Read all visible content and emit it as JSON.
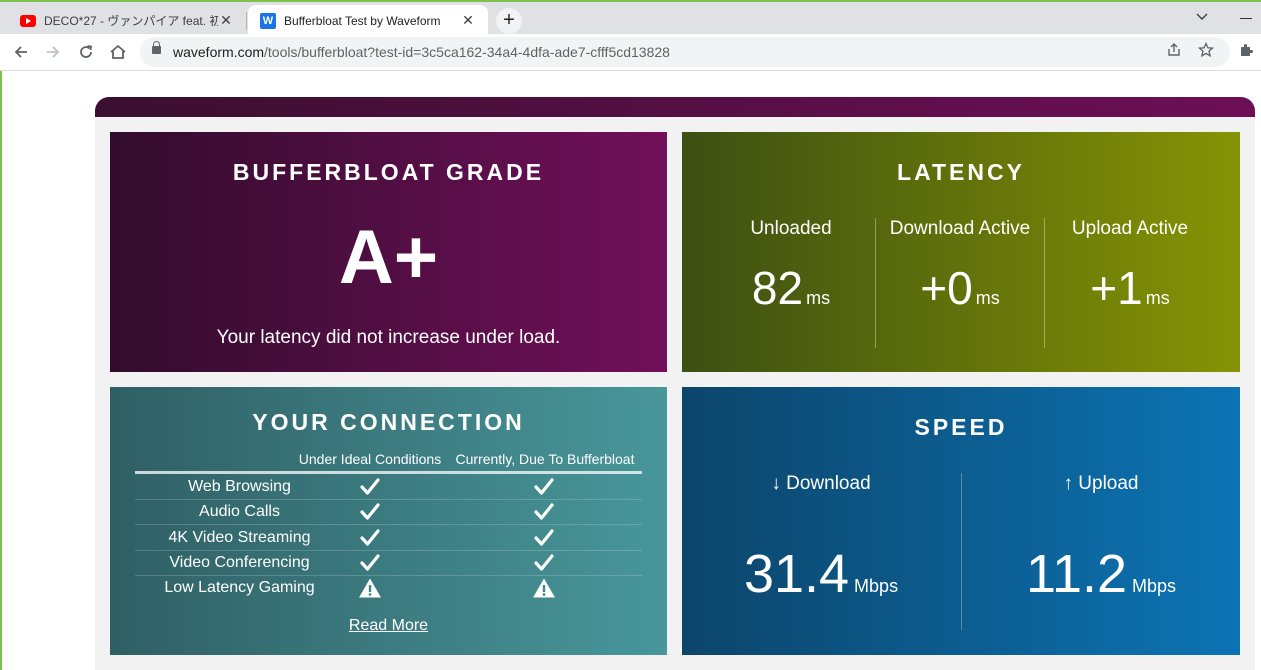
{
  "browser": {
    "tabs": [
      {
        "title": "DECO*27 - ヴァンパイア feat. 初音ミ",
        "icon": "youtube-icon"
      },
      {
        "title": "Bufferbloat Test by Waveform",
        "icon": "waveform-icon",
        "favicon_letter": "W"
      }
    ],
    "new_tab": "+",
    "close": "✕",
    "url_host": "waveform.com",
    "url_path": "/tools/bufferbloat?test-id=3c5ca162-34a4-4dfa-ade7-cfff5cd13828"
  },
  "grade_card": {
    "heading": "BUFFERBLOAT GRADE",
    "grade": "A+",
    "message": "Your latency did not increase under load."
  },
  "latency_card": {
    "heading": "LATENCY",
    "columns": [
      {
        "label": "Unloaded",
        "value": "82",
        "unit": "ms"
      },
      {
        "label": "Download Active",
        "value": "+0",
        "unit": "ms"
      },
      {
        "label": "Upload Active",
        "value": "+1",
        "unit": "ms"
      }
    ]
  },
  "connection_card": {
    "heading": "YOUR CONNECTION",
    "columns": [
      "Under Ideal Conditions",
      "Currently, Due To Bufferbloat"
    ],
    "rows": [
      {
        "label": "Web Browsing",
        "ideal": "check",
        "current": "check"
      },
      {
        "label": "Audio Calls",
        "ideal": "check",
        "current": "check"
      },
      {
        "label": "4K Video Streaming",
        "ideal": "check",
        "current": "check"
      },
      {
        "label": "Video Conferencing",
        "ideal": "check",
        "current": "check"
      },
      {
        "label": "Low Latency Gaming",
        "ideal": "warning",
        "current": "warning"
      }
    ],
    "read_more": "Read More"
  },
  "speed_card": {
    "heading": "SPEED",
    "download": {
      "label": "↓ Download",
      "value": "31.4",
      "unit": "Mbps"
    },
    "upload": {
      "label": "↑ Upload",
      "value": "11.2",
      "unit": "Mbps"
    }
  },
  "colors": {
    "grade_gradient": [
      "#320c2c",
      "#71105a"
    ],
    "latency_gradient": [
      "#3d4f12",
      "#859404"
    ],
    "connection_gradient": [
      "#2f5f64",
      "#48979b"
    ],
    "speed_gradient": [
      "#0c456b",
      "#0c74b4"
    ]
  }
}
